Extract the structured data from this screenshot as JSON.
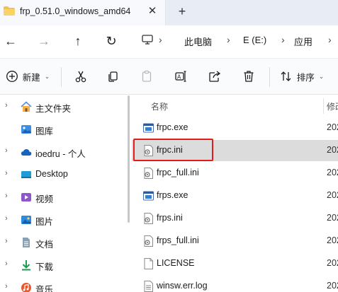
{
  "tab": {
    "title": "frp_0.51.0_windows_amd64",
    "close_symbol": "✕",
    "new_tab_symbol": "+"
  },
  "nav": {
    "back": "←",
    "forward": "→",
    "up": "↑",
    "refresh": "↻"
  },
  "address": {
    "crumbs": [
      "此电脑",
      "E (E:)",
      "应用"
    ],
    "separator": "›"
  },
  "toolbar": {
    "new_label": "新建",
    "sort_label": "排序",
    "chevron": "⌄"
  },
  "sidebar": {
    "items": [
      {
        "label": "主文件夹",
        "caret": "›",
        "icon": "home-icon"
      },
      {
        "label": "图库",
        "caret": "",
        "icon": "gallery-icon"
      },
      {
        "label": "ioedru - 个人",
        "caret": "›",
        "icon": "cloud-icon"
      },
      {
        "label": "Desktop",
        "caret": "›",
        "icon": "desktop-icon"
      },
      {
        "label": "视频",
        "caret": "›",
        "icon": "video-icon"
      },
      {
        "label": "图片",
        "caret": "›",
        "icon": "pictures-icon"
      },
      {
        "label": "文档",
        "caret": "›",
        "icon": "documents-icon"
      },
      {
        "label": "下载",
        "caret": "›",
        "icon": "downloads-icon"
      },
      {
        "label": "音乐",
        "caret": "›",
        "icon": "music-icon"
      }
    ]
  },
  "file_list": {
    "columns": {
      "name": "名称",
      "modified": "修改"
    },
    "files": [
      {
        "name": "frpc.exe",
        "date": "202",
        "type": "exe"
      },
      {
        "name": "frpc.ini",
        "date": "202",
        "type": "ini",
        "selected": true
      },
      {
        "name": "frpc_full.ini",
        "date": "202",
        "type": "ini"
      },
      {
        "name": "frps.exe",
        "date": "202",
        "type": "exe"
      },
      {
        "name": "frps.ini",
        "date": "202",
        "type": "ini"
      },
      {
        "name": "frps_full.ini",
        "date": "202",
        "type": "ini"
      },
      {
        "name": "LICENSE",
        "date": "202",
        "type": "file"
      },
      {
        "name": "winsw.err.log",
        "date": "202",
        "type": "file"
      }
    ]
  },
  "colors": {
    "highlight_box": "#e21b1b",
    "folder": "#f2c14e",
    "selection": "#dcdcdc"
  }
}
